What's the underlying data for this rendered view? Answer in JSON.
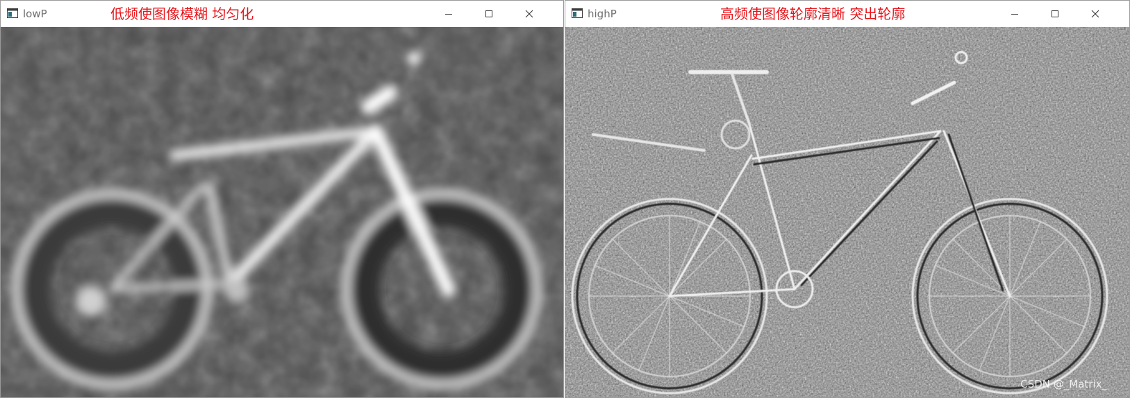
{
  "windows": [
    {
      "title": "lowP",
      "annotation": "低频使图像模糊 均匀化",
      "image": "low-pass filtered bicycle (blurred)"
    },
    {
      "title": "highP",
      "annotation": "高频使图像轮廓清晰 突出轮廓",
      "image": "high-pass filtered bicycle (edges)",
      "watermark": "CSDN @_Matrix_"
    }
  ],
  "icons": [
    "app-window-icon",
    "minimize-icon",
    "maximize-icon",
    "close-icon"
  ],
  "colors": {
    "annotation": "#e8141a",
    "title_text": "#6e6e6e",
    "low_bg": "#5c5c5c",
    "high_bg": "#8a8a8a"
  }
}
